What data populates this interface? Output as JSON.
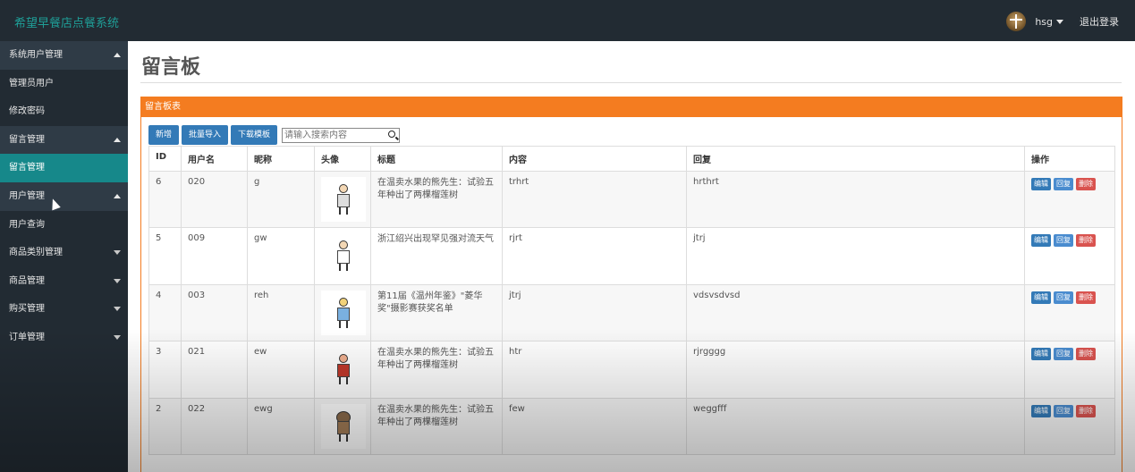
{
  "app": {
    "title": "希望早餐店点餐系统",
    "user": "hsg",
    "logout_label": "退出登录"
  },
  "sidebar": {
    "items": [
      {
        "label": "系统用户管理",
        "type": "group",
        "expanded": true
      },
      {
        "label": "管理员用户",
        "type": "item"
      },
      {
        "label": "修改密码",
        "type": "item"
      },
      {
        "label": "留言管理",
        "type": "group",
        "expanded": true
      },
      {
        "label": "留言管理",
        "type": "item",
        "active": true
      },
      {
        "label": "用户管理",
        "type": "group",
        "expanded": true
      },
      {
        "label": "用户查询",
        "type": "item"
      },
      {
        "label": "商品类别管理",
        "type": "group",
        "expanded": false
      },
      {
        "label": "商品管理",
        "type": "group",
        "expanded": false
      },
      {
        "label": "购买管理",
        "type": "group",
        "expanded": false
      },
      {
        "label": "订单管理",
        "type": "group",
        "expanded": false
      }
    ]
  },
  "page": {
    "title": "留言板",
    "panel_title": "留言板表"
  },
  "toolbar": {
    "add_label": "新增",
    "import_label": "批量导入",
    "template_label": "下载模板",
    "search_placeholder": "请输入搜索内容"
  },
  "table": {
    "headers": [
      "ID",
      "用户名",
      "昵称",
      "头像",
      "标题",
      "内容",
      "回复",
      "操作"
    ],
    "rows": [
      {
        "id": "6",
        "username": "020",
        "nickname": "g",
        "avatar": "cartoon-chef-icon",
        "title": "在温卖水果的熊先生：试验五年种出了两棵榴莲树",
        "content": "trhrt",
        "reply": "hrthrt"
      },
      {
        "id": "5",
        "username": "009",
        "nickname": "gw",
        "avatar": "cartoon-figure-icon",
        "title": "浙江绍兴出现罕见强对流天气",
        "content": "rjrt",
        "reply": "jtrj"
      },
      {
        "id": "4",
        "username": "003",
        "nickname": "reh",
        "avatar": "cartoon-boy-icon",
        "title": "第11届《温州年鉴》\"菱华奖\"摄影赛获奖名单",
        "content": "jtrj",
        "reply": "vdsvsdvsd"
      },
      {
        "id": "3",
        "username": "021",
        "nickname": "ew",
        "avatar": "cartoon-kid-icon",
        "title": "在温卖水果的熊先生：试验五年种出了两棵榴莲树",
        "content": "htr",
        "reply": "rjrgggg"
      },
      {
        "id": "2",
        "username": "022",
        "nickname": "ewg",
        "avatar": "cartoon-raccoon-icon",
        "title": "在温卖水果的熊先生：试验五年种出了两棵榴莲树",
        "content": "few",
        "reply": "weggfff"
      }
    ],
    "actions": {
      "edit": "编辑",
      "reply": "回复",
      "delete": "删除"
    }
  }
}
